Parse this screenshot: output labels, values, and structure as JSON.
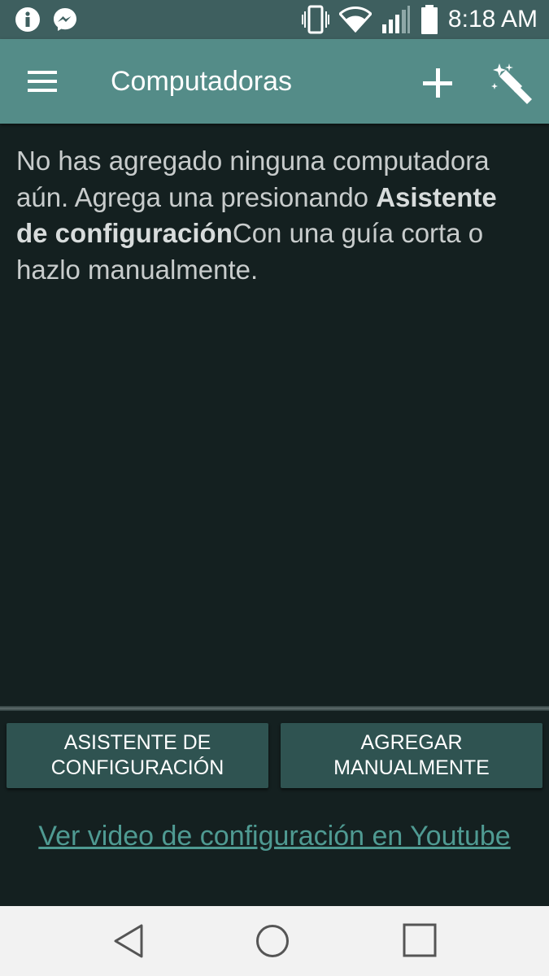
{
  "status_bar": {
    "time": "8:18 AM",
    "left_icons": [
      "info-icon",
      "messenger-icon"
    ],
    "right_icons": [
      "vibrate-icon",
      "wifi-icon",
      "signal-icon",
      "battery-icon"
    ]
  },
  "app_bar": {
    "title": "Computadoras",
    "menu_icon": "hamburger-menu-icon",
    "add_icon": "plus-icon",
    "wizard_icon": "magic-wand-icon"
  },
  "main": {
    "message_part1": "No has agregado ninguna computadora aún. Agrega una presionando ",
    "message_bold": "Asistente de configuración",
    "message_part2": "Con una guía corta o hazlo manualmente."
  },
  "buttons": {
    "wizard_line1": "ASISTENTE DE",
    "wizard_line2": "CONFIGURACIÓN",
    "manual_line1": "AGREGAR",
    "manual_line2": "MANUALMENTE"
  },
  "youtube_link": "Ver video de configuración en Youtube",
  "nav_bar": {
    "icons": [
      "back-icon",
      "home-icon",
      "recents-icon"
    ]
  },
  "colors": {
    "app_bar": "#548c88",
    "status_bar": "#3e5f5f",
    "background": "#142020",
    "button": "#2f5351",
    "link": "#4f9a92",
    "nav_bar": "#f2f2f2"
  }
}
